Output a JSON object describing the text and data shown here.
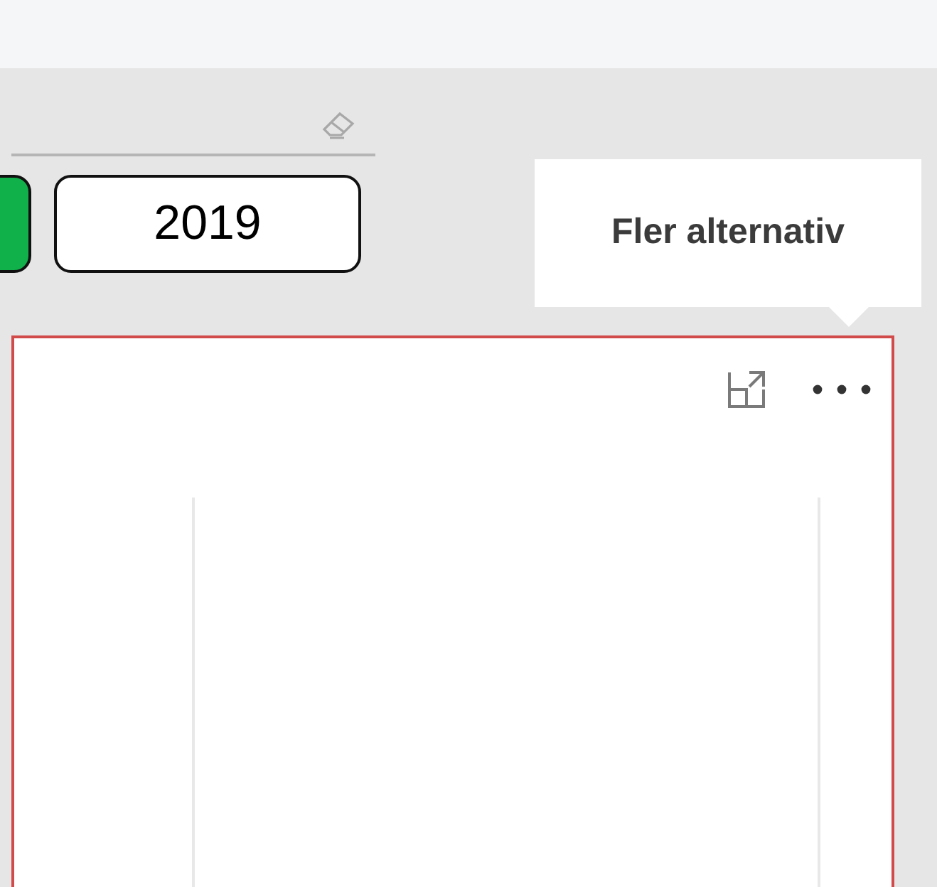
{
  "slicer": {
    "buttons": [
      {
        "selected": true
      },
      {
        "label": "2019",
        "selected": false
      }
    ]
  },
  "tooltip": {
    "text": "Fler alternativ"
  }
}
